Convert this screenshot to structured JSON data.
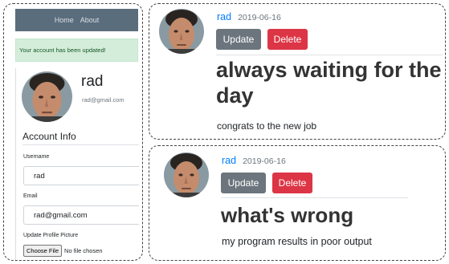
{
  "nav": {
    "home": "Home",
    "about": "About"
  },
  "alert": {
    "message": "Your account has been updated!"
  },
  "profile": {
    "name": "rad",
    "email": "rad@gmail.com",
    "section_title": "Account Info",
    "username_label": "Username",
    "username_value": "rad",
    "email_label": "Email",
    "email_value": "rad@gmail.com",
    "picture_label": "Update Profile Picture",
    "file_button": "Choose File",
    "file_status": "No file chosen"
  },
  "posts": [
    {
      "author": "rad",
      "date": "2019-06-16",
      "update_label": "Update",
      "delete_label": "Delete",
      "title": "always waiting for the day",
      "content": "congrats to the new job"
    },
    {
      "author": "rad",
      "date": "2019-06-16",
      "update_label": "Update",
      "delete_label": "Delete",
      "title": "what's wrong",
      "content": "my program results in poor output"
    }
  ],
  "colors": {
    "navbar": "#5a6d7d",
    "alert_bg": "#d4edda",
    "alert_text": "#155724",
    "link": "#007bff",
    "update": "#6c757d",
    "delete": "#dc3545"
  }
}
